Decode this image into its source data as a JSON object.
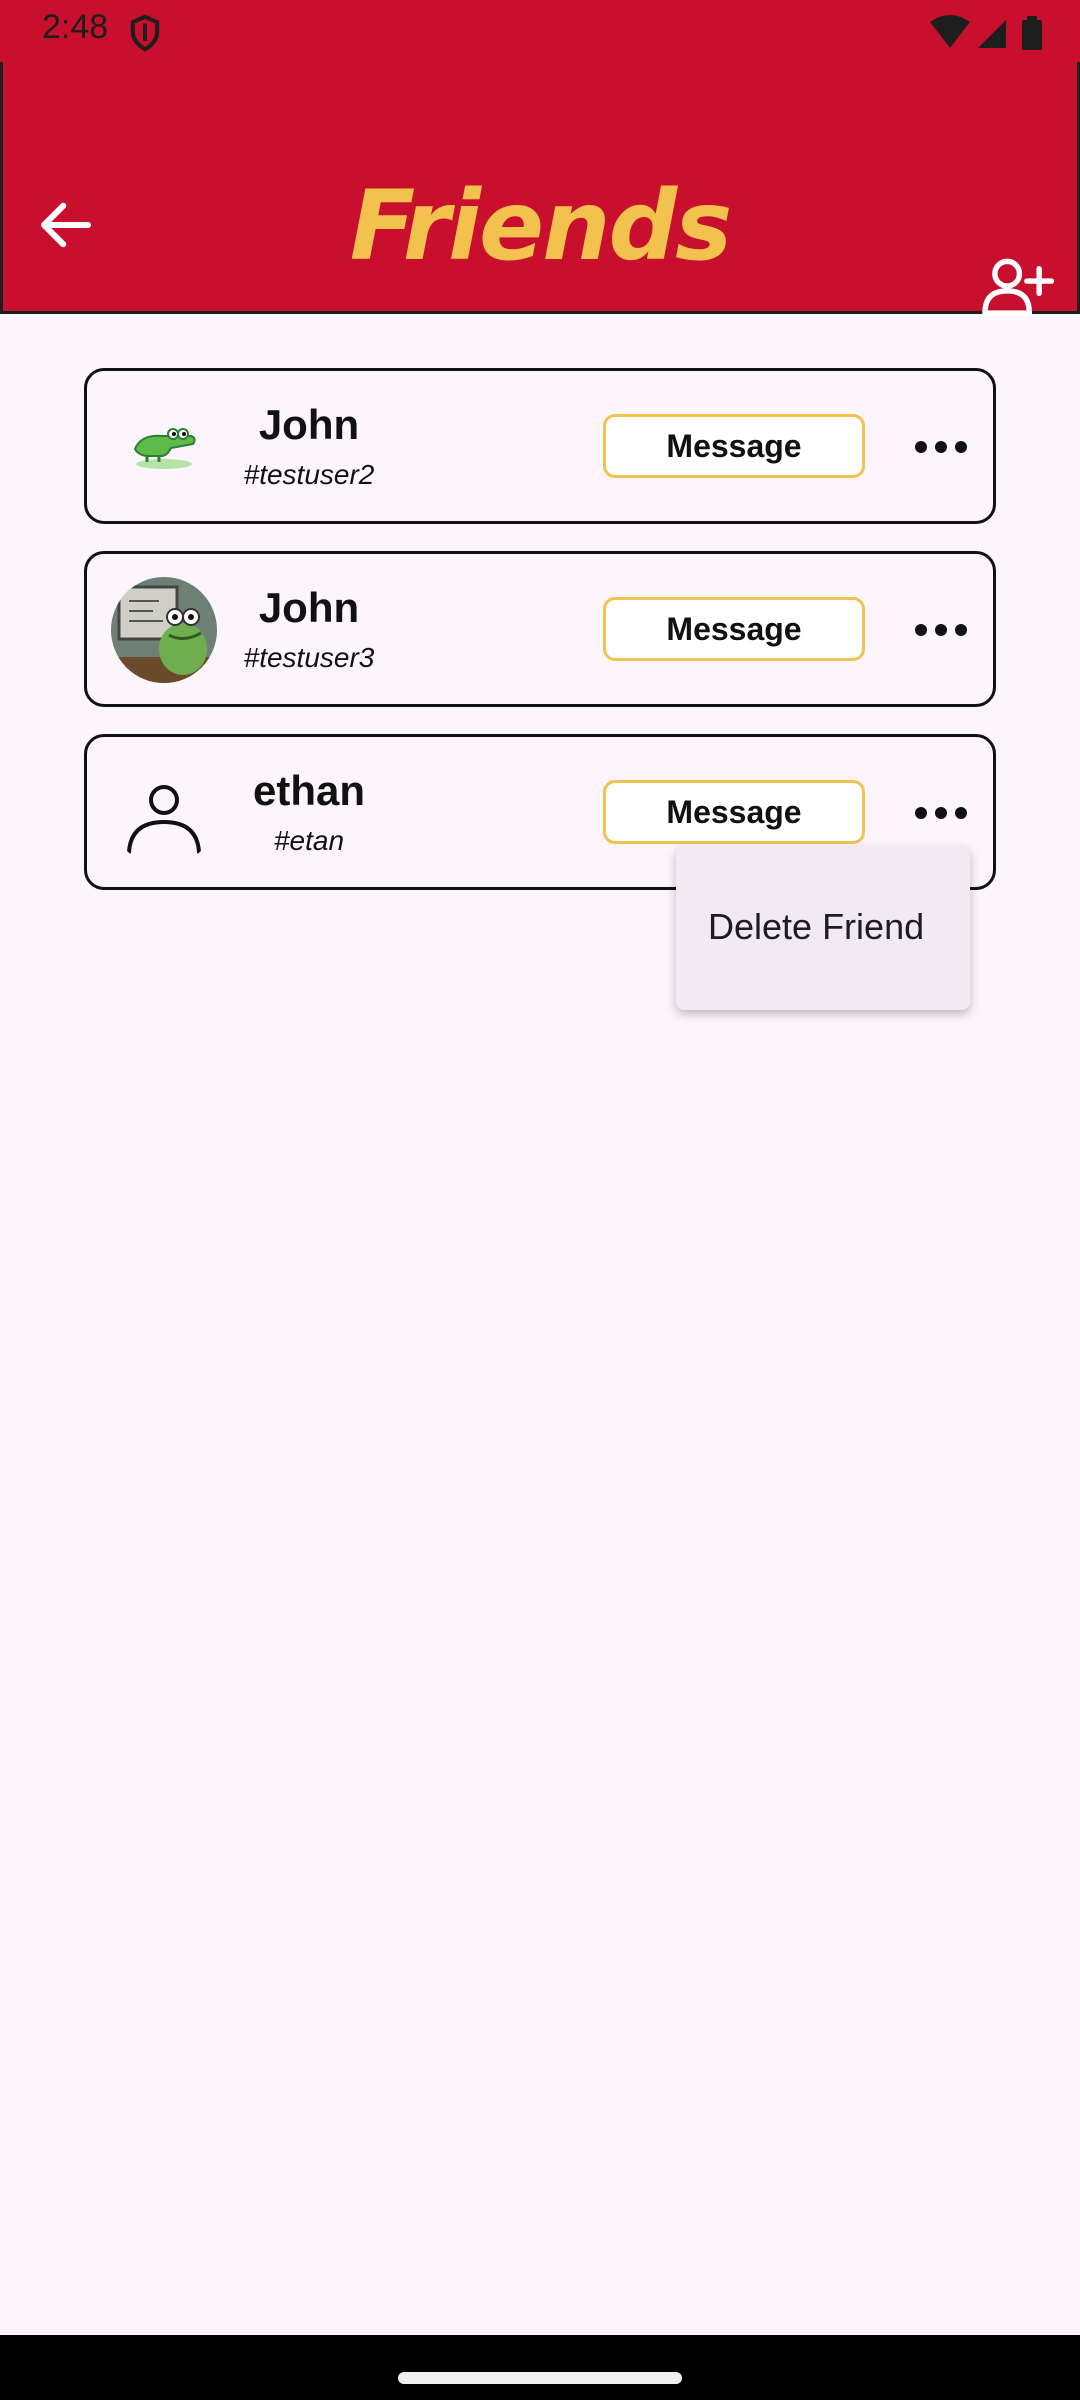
{
  "status_bar": {
    "time": "2:48",
    "background": "#C8102E"
  },
  "app_bar": {
    "title": "Friends",
    "title_color": "#F2C14E",
    "background": "#C8102E",
    "back_icon": "arrow-left-icon",
    "action_icon": "person-add-icon"
  },
  "friends": [
    {
      "name": "John",
      "handle": "#testuser2",
      "avatar": "crocodile-avatar",
      "message_label": "Message"
    },
    {
      "name": "John",
      "handle": "#testuser3",
      "avatar": "crocodile-photo-avatar",
      "message_label": "Message"
    },
    {
      "name": "ethan",
      "handle": "#etan",
      "avatar": "person-outline-avatar",
      "message_label": "Message"
    }
  ],
  "popup_menu": {
    "items": [
      "Delete Friend"
    ]
  }
}
